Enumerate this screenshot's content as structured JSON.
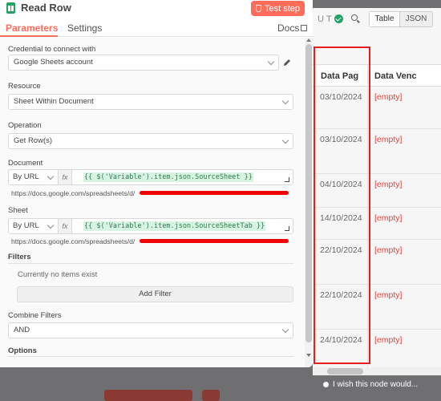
{
  "header": {
    "title": "Read Row",
    "test_button": "Test step"
  },
  "tabs": {
    "parameters": "Parameters",
    "settings": "Settings",
    "docs": "Docs"
  },
  "fields": {
    "credential_label": "Credential to connect with",
    "credential_value": "Google Sheets account",
    "resource_label": "Resource",
    "resource_value": "Sheet Within Document",
    "operation_label": "Operation",
    "operation_value": "Get Row(s)",
    "document_label": "Document",
    "document_mode": "By URL",
    "document_expr": "{{ $('Variable').item.json.SourceSheet }}",
    "document_url": "https://docs.google.com/spreadsheets/d/",
    "sheet_label": "Sheet",
    "sheet_mode": "By URL",
    "sheet_expr": "{{ $('Variable').item.json.SourceSheetTab }}",
    "sheet_url": "https://docs.google.com/spreadsheets/d/",
    "fx": "fx"
  },
  "filters": {
    "title": "Filters",
    "empty": "Currently no items exist",
    "add": "Add Filter"
  },
  "combine": {
    "label": "Combine Filters",
    "value": "AND"
  },
  "options": {
    "title": "Options"
  },
  "output": {
    "status_text": "UT",
    "view_table": "Table",
    "view_json": "JSON",
    "columns": [
      "Data Pag",
      "Data Venc"
    ],
    "rows": [
      {
        "date": "03/10/2024",
        "venc": "[empty]"
      },
      {
        "date": "03/10/2024",
        "venc": "[empty]"
      },
      {
        "date": "04/10/2024",
        "venc": "[empty]"
      },
      {
        "date": "14/10/2024",
        "venc": "[empty]"
      },
      {
        "date": "22/10/2024",
        "venc": "[empty]"
      },
      {
        "date": "22/10/2024",
        "venc": "[empty]"
      },
      {
        "date": "24/10/2024",
        "venc": "[empty]"
      }
    ],
    "hint": "I wish this node would..."
  },
  "colors": {
    "accent": "#ff6d5a",
    "empty": "#e0443b",
    "highlight": "#e61e1e"
  },
  "icons": [
    "sheets-icon",
    "flask-icon",
    "external-link-icon",
    "pencil-icon",
    "chevron-down-icon",
    "expand-icon",
    "check-icon",
    "search-icon",
    "lightbulb-icon"
  ]
}
